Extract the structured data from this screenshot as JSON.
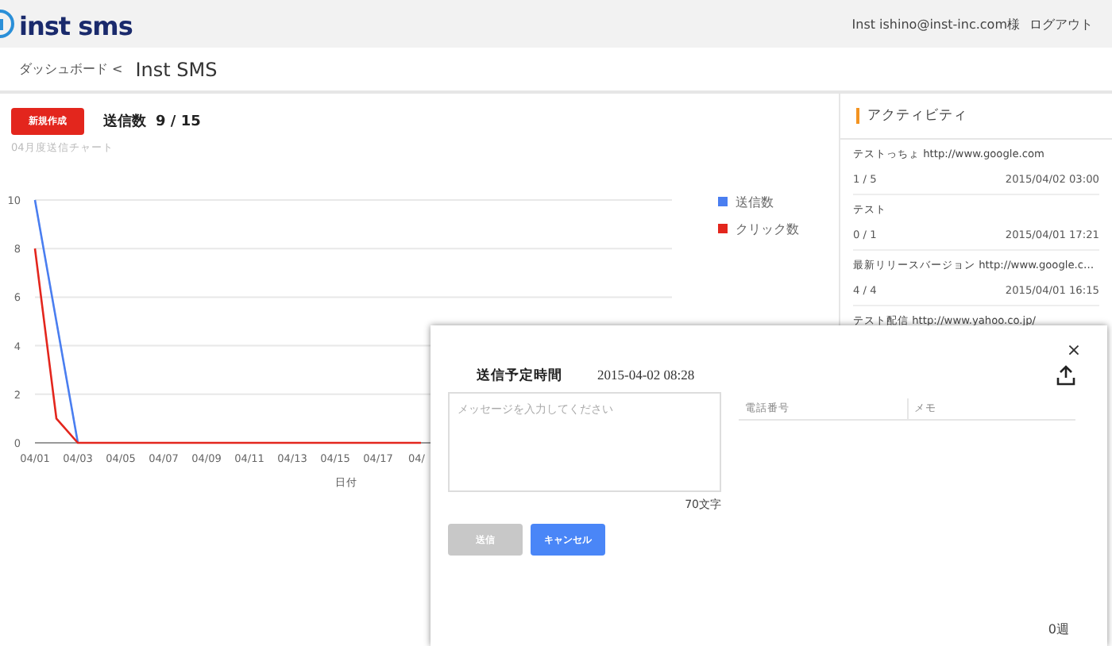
{
  "header": {
    "logo": "inst sms",
    "user": "Inst ishino@inst-inc.com様",
    "logout": "ログアウト"
  },
  "breadcrumb": {
    "parent": "ダッシュボード <",
    "current": "Inst SMS"
  },
  "main": {
    "new_button": "新規作成",
    "sent_label": "送信数",
    "sent_count": "9 / 15",
    "chart_title": "04月度送信チャート",
    "chart_data": {
      "type": "line",
      "xlabel": "日付",
      "categories": [
        "04/01",
        null,
        "04/03",
        null,
        "04/05",
        null,
        "04/07",
        null,
        "04/09",
        null,
        "04/11",
        null,
        "04/13",
        null,
        "04/15",
        null,
        "04/17",
        null,
        "04/"
      ],
      "series": [
        {
          "name": "送信数",
          "color": "#4a7ef0",
          "values": [
            10,
            5,
            0,
            null,
            null,
            null,
            null,
            null,
            null,
            null,
            null,
            null,
            null,
            null,
            null,
            null,
            null,
            null,
            null
          ]
        },
        {
          "name": "クリック数",
          "color": "#e3261d",
          "values": [
            8,
            1,
            0,
            0,
            0,
            0,
            0,
            0,
            0,
            0,
            0,
            0,
            0,
            0,
            0,
            0,
            0,
            0,
            0
          ]
        }
      ],
      "ylim": [
        0,
        10
      ],
      "yticks": [
        0,
        2,
        4,
        6,
        8,
        10
      ],
      "grid": true,
      "legend": true
    }
  },
  "activity": {
    "title": "アクティビティ",
    "items": [
      {
        "title": "テストっちょ http://www.google.com",
        "count": "1 / 5",
        "date": "2015/04/02 03:00"
      },
      {
        "title": "テスト",
        "count": "0 / 1",
        "date": "2015/04/01 17:21"
      },
      {
        "title": "最新リリースバージョン http://www.google.c…",
        "count": "4 / 4",
        "date": "2015/04/01 16:15"
      },
      {
        "title": "テスト配信 http://www.yahoo.co.jp/"
      }
    ]
  },
  "modal": {
    "close": "×",
    "schedule_label": "送信予定時間",
    "schedule_value": "2015-04-02 08:28",
    "message": {
      "placeholder": "メッセージを入力してください"
    },
    "char_count": "70文字",
    "columns": [
      "電話番号",
      "メモ"
    ],
    "buttons": [
      {
        "label": "送信",
        "disabled": true
      },
      {
        "label": "キャンセル",
        "disabled": false
      }
    ],
    "footer": "0週"
  }
}
